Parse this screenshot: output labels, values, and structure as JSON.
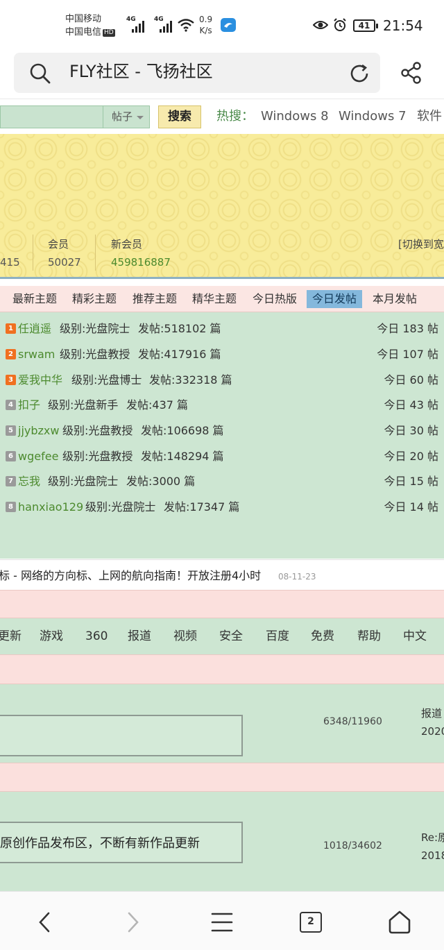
{
  "status_bar": {
    "carrier1": "中国移动",
    "carrier2": "中国电信",
    "hd_badge": "HD",
    "net1": "4G",
    "net2": "4G",
    "speed_value": "0.9",
    "speed_unit": "K/s",
    "battery": "41",
    "time": "21:54"
  },
  "browser": {
    "page_title": "FLY社区 - 飞扬社区"
  },
  "search": {
    "input_value": "",
    "type_select": "帖子",
    "button": "搜索",
    "hot_label": "热搜：",
    "hot_items": [
      "Windows 8",
      "Windows 7",
      "软件"
    ]
  },
  "stats": {
    "partial_value": "415",
    "members_label": "会员",
    "members_value": "50027",
    "new_member_label": "新会员",
    "new_member_value": "459816887",
    "switch_width": "[切换到宽"
  },
  "tabs": [
    "最新主题",
    "精彩主题",
    "推荐主题",
    "精华主题",
    "今日热版",
    "今日发帖",
    "本月发帖"
  ],
  "active_tab": "今日发帖",
  "rank_list": [
    {
      "rank": "1",
      "name": "任逍遥",
      "level": "级别:光盘院士",
      "posts": "发帖:518102 篇",
      "today": "今日 183 帖"
    },
    {
      "rank": "2",
      "name": "srwam",
      "level": "级别:光盘教授",
      "posts": "发帖:417916 篇",
      "today": "今日 107 帖"
    },
    {
      "rank": "3",
      "name": "爱我中华",
      "level": "级别:光盘博士",
      "posts": "发帖:332318 篇",
      "today": "今日 60 帖"
    },
    {
      "rank": "4",
      "name": "扣子",
      "level": "级别:光盘新手",
      "posts": "发帖:437 篇",
      "today": "今日 43 帖"
    },
    {
      "rank": "5",
      "name": "jjybzxw",
      "level": "级别:光盘教授",
      "posts": "发帖:106698 篇",
      "today": "今日 30 帖"
    },
    {
      "rank": "6",
      "name": "wgefee",
      "level": "级别:光盘教授",
      "posts": "发帖:148294 篇",
      "today": "今日 20 帖"
    },
    {
      "rank": "7",
      "name": "忘我",
      "level": "级别:光盘院士",
      "posts": "发帖:3000 篇",
      "today": "今日 15 帖"
    },
    {
      "rank": "8",
      "name": "hanxiao129",
      "level": "级别:光盘院士",
      "posts": "发帖:17347 篇",
      "today": "今日 14 帖"
    }
  ],
  "notice": {
    "text": "标 - 网络的方向标、上网的航向指南！开放注册4小时",
    "date": "08-11-23"
  },
  "categories": [
    "更新",
    "游戏",
    "360",
    "报道",
    "视频",
    "安全",
    "百度",
    "免费",
    "帮助",
    "中文"
  ],
  "forums": [
    {
      "desc": "",
      "counts": "6348/11960",
      "last_title": "报道",
      "last_date": "2020"
    },
    {
      "desc": "原创作品发布区，不断有新作品更新",
      "counts": "1018/34602",
      "last_title": "Re:原",
      "last_date": "2018"
    }
  ],
  "bottom_nav": {
    "tab_count": "2"
  },
  "colors": {
    "accent_green": "#cde6d2",
    "tab_active": "#84b8dc",
    "banner_yellow": "#f8ec9a",
    "username_green": "#4c8a2e"
  }
}
